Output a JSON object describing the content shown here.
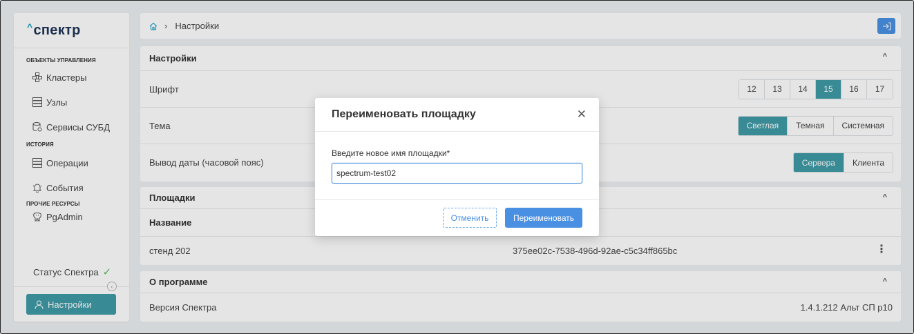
{
  "app": {
    "logo": "спектр"
  },
  "sidebar": {
    "section_manage": "ОБЪЕКТЫ УПРАВЛЕНИЯ",
    "clusters": "Кластеры",
    "nodes": "Узлы",
    "dbms_services": "Сервисы СУБД",
    "section_history": "ИСТОРИЯ",
    "operations": "Операции",
    "events": "События",
    "section_other": "ПРОЧИЕ РЕСУРСЫ",
    "pgadmin": "PgAdmin",
    "status": "Статус Спектра",
    "settings": "Настройки"
  },
  "breadcrumb": {
    "current": "Настройки"
  },
  "settings_panel": {
    "title": "Настройки",
    "font_label": "Шрифт",
    "font_sizes": [
      "12",
      "13",
      "14",
      "15",
      "16",
      "17"
    ],
    "font_selected": "15",
    "theme_label": "Тема",
    "theme_options": [
      "Светлая",
      "Темная",
      "Системная"
    ],
    "theme_selected": "Светлая",
    "date_label": "Вывод даты (часовой пояс)",
    "date_options": [
      "Сервера",
      "Клиента"
    ],
    "date_selected": "Сервера"
  },
  "sites_panel": {
    "title": "Площадки",
    "col_name": "Название",
    "row_name": "стенд 202",
    "row_id": "375ee02c-7538-496d-92ae-c5c34ff865bc"
  },
  "about_panel": {
    "title": "О программе",
    "version_label": "Версия Спектра",
    "version_value": "1.4.1.212 Альт СП р10"
  },
  "modal": {
    "title": "Переименовать площадку",
    "field_label": "Введите новое имя площадки*",
    "field_value": "spectrum-test02",
    "cancel": "Отменить",
    "confirm": "Переименовать"
  },
  "colors": {
    "accent": "#3f9aa6",
    "primary": "#4a90e2",
    "status_ok": "#5cb85c"
  }
}
